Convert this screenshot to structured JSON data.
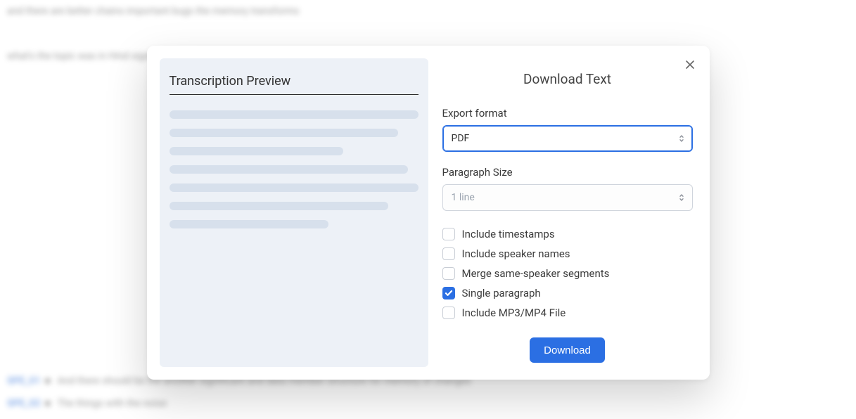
{
  "modal": {
    "title": "Download Text",
    "preview_title": "Transcription Preview",
    "fields": {
      "export_format": {
        "label": "Export format",
        "value": "PDF"
      },
      "paragraph_size": {
        "label": "Paragraph Size",
        "value": "1 line"
      }
    },
    "options": {
      "include_timestamps": {
        "label": "Include timestamps",
        "checked": false
      },
      "include_speakers": {
        "label": "Include speaker names",
        "checked": false
      },
      "merge_speaker": {
        "label": "Merge same-speaker segments",
        "checked": false
      },
      "single_paragraph": {
        "label": "Single paragraph",
        "checked": true
      },
      "include_media": {
        "label": "Include MP3/MP4 File",
        "checked": false
      }
    },
    "download_label": "Download"
  },
  "colors": {
    "accent": "#2b6fe3"
  }
}
